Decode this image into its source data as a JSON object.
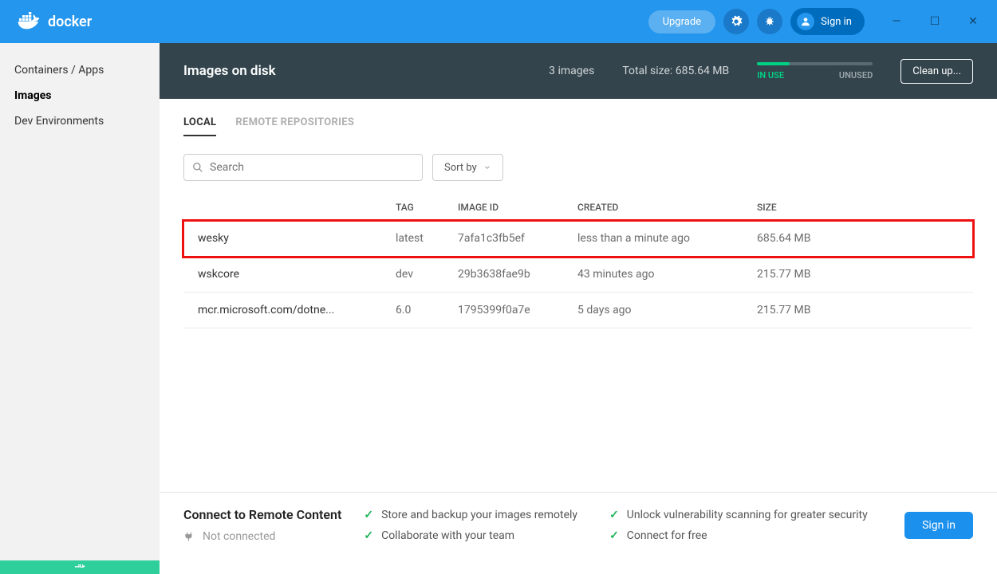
{
  "app": {
    "name": "docker"
  },
  "titlebar": {
    "upgrade": "Upgrade",
    "signin": "Sign in"
  },
  "sidebar": {
    "items": [
      {
        "label": "Containers / Apps",
        "active": false
      },
      {
        "label": "Images",
        "active": true
      },
      {
        "label": "Dev Environments",
        "active": false
      }
    ]
  },
  "header": {
    "title": "Images on disk",
    "count_text": "3 images",
    "total_text": "Total size: 685.64 MB",
    "in_use_label": "IN USE",
    "unused_label": "UNUSED",
    "cleanup": "Clean up..."
  },
  "tabs": [
    {
      "label": "LOCAL",
      "active": true
    },
    {
      "label": "REMOTE REPOSITORIES",
      "active": false
    }
  ],
  "toolbar": {
    "search_placeholder": "Search",
    "sort_label": "Sort by"
  },
  "table": {
    "columns": {
      "name": "",
      "tag": "TAG",
      "id": "IMAGE ID",
      "created": "CREATED",
      "size": "SIZE"
    },
    "rows": [
      {
        "name": "wesky",
        "tag": "latest",
        "id": "7afa1c3fb5ef",
        "created": "less than a minute ago",
        "size": "685.64 MB",
        "highlighted": true
      },
      {
        "name": "wskcore",
        "tag": "dev",
        "id": "29b3638fae9b",
        "created": "43 minutes ago",
        "size": "215.77 MB",
        "highlighted": false
      },
      {
        "name": "mcr.microsoft.com/dotne...",
        "tag": "6.0",
        "id": "1795399f0a7e",
        "created": "5 days ago",
        "size": "215.77 MB",
        "highlighted": false
      }
    ]
  },
  "footer": {
    "title": "Connect to Remote Content",
    "status": "Not connected",
    "benefits": [
      "Store and backup your images remotely",
      "Collaborate with your team",
      "Unlock vulnerability scanning for greater security",
      "Connect for free"
    ],
    "signin": "Sign in"
  }
}
